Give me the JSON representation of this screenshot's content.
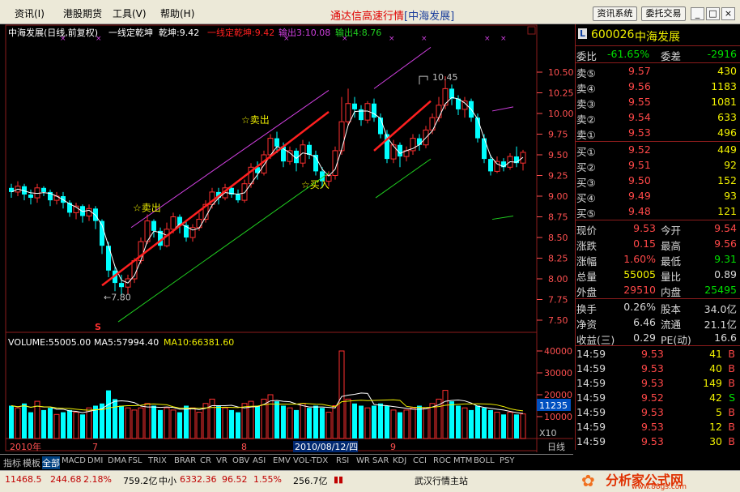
{
  "menu": {
    "items": [
      "资讯(I)",
      "港股期货",
      "工具(V)",
      "帮助(H)"
    ]
  },
  "app_title": {
    "prefix": "通达信高速行情",
    "stock": "[中海发展]"
  },
  "toolbar": {
    "info_system": "资讯系统",
    "order_trade": "委托交易",
    "min": "_",
    "max": "□",
    "close": "×"
  },
  "chart": {
    "header": {
      "name": "中海发展(日线,前复权)",
      "indicator": "一线定乾坤",
      "qk": "乾坤:9.42",
      "line_val": "一线定乾坤:9.42",
      "out": "输出3:10.08",
      "out4": "输出4:8.76"
    },
    "y_ticks": [
      "10.50",
      "10.25",
      "10.00",
      "9.75",
      "9.50",
      "9.25",
      "9.00",
      "8.75",
      "8.50",
      "8.25",
      "8.00",
      "7.75",
      "7.50"
    ],
    "annotations": {
      "sell1": "☆卖出",
      "sell2": "☆卖出",
      "buy": "☆买入",
      "low": "7.80",
      "high": "10.45",
      "s": "S"
    },
    "volume_header": {
      "vol": "VOLUME:55005.00",
      "ma5": "MA5:57994.40",
      "ma10": "MA10:66381.60"
    },
    "vol_ticks": [
      "40000",
      "30000",
      "20000",
      "10000"
    ],
    "vol_badge": "11235",
    "vol_unit": "X10",
    "dates": {
      "year": "2010年",
      "m7": "7",
      "m8": "8",
      "cursor": "2010/08/12/四",
      "m9": "9"
    },
    "period": "日线",
    "colors": {
      "up": "#ff3030",
      "down": "#00ffff",
      "trend": "#ff2020",
      "channel_top": "#d040e0",
      "channel_bottom": "#20d020"
    }
  },
  "tabs": [
    "指标",
    "模板",
    "全部",
    "MACD",
    "DMI",
    "DMA",
    "FSL",
    "TRIX",
    "BRAR",
    "CR",
    "VR",
    "OBV",
    "ASI",
    "EMV",
    "VOL-TDX",
    "RSI",
    "WR",
    "SAR",
    "KDJ",
    "CCI",
    "ROC",
    "MTM",
    "BOLL",
    "PSY"
  ],
  "quote": {
    "code": "600026",
    "name": "中海发展",
    "logo": "L",
    "weibi_label": "委比",
    "weibi": "-61.65%",
    "weicha_label": "委差",
    "weicha": "-2916",
    "asks": [
      {
        "label": "卖⑤",
        "price": "9.57",
        "vol": "430"
      },
      {
        "label": "卖④",
        "price": "9.56",
        "vol": "1183"
      },
      {
        "label": "卖③",
        "price": "9.55",
        "vol": "1081"
      },
      {
        "label": "卖②",
        "price": "9.54",
        "vol": "633"
      },
      {
        "label": "卖①",
        "price": "9.53",
        "vol": "496"
      }
    ],
    "bids": [
      {
        "label": "买①",
        "price": "9.52",
        "vol": "449"
      },
      {
        "label": "买②",
        "price": "9.51",
        "vol": "92"
      },
      {
        "label": "买③",
        "price": "9.50",
        "vol": "152"
      },
      {
        "label": "买④",
        "price": "9.49",
        "vol": "93"
      },
      {
        "label": "买⑤",
        "price": "9.48",
        "vol": "121"
      }
    ],
    "stats": [
      {
        "l1": "现价",
        "v1": "9.53",
        "l2": "今开",
        "v2": "9.54"
      },
      {
        "l1": "涨跌",
        "v1": "0.15",
        "l2": "最高",
        "v2": "9.56"
      },
      {
        "l1": "涨幅",
        "v1": "1.60%",
        "l2": "最低",
        "v2": "9.31"
      },
      {
        "l1": "总量",
        "v1": "55005",
        "l2": "量比",
        "v2": "0.89"
      },
      {
        "l1": "外盘",
        "v1": "29510",
        "l2": "内盘",
        "v2": "25495"
      }
    ],
    "fund": [
      {
        "l1": "换手",
        "v1": "0.26%",
        "l2": "股本",
        "v2": "34.0亿"
      },
      {
        "l1": "净资",
        "v1": "6.46",
        "l2": "流通",
        "v2": "21.1亿"
      },
      {
        "l1": "收益(三)",
        "v1": "0.29",
        "l2": "PE(动)",
        "v2": "16.6"
      }
    ],
    "ticks": [
      {
        "t": "14:59",
        "p": "9.53",
        "v": "41",
        "d": "B"
      },
      {
        "t": "14:59",
        "p": "9.53",
        "v": "40",
        "d": "B"
      },
      {
        "t": "14:59",
        "p": "9.53",
        "v": "149",
        "d": "B"
      },
      {
        "t": "14:59",
        "p": "9.52",
        "v": "42",
        "d": "S"
      },
      {
        "t": "14:59",
        "p": "9.53",
        "v": "5",
        "d": "B"
      },
      {
        "t": "14:59",
        "p": "9.53",
        "v": "12",
        "d": "B"
      },
      {
        "t": "14:59",
        "p": "9.53",
        "v": "30",
        "d": "B"
      }
    ]
  },
  "status": {
    "idx1": "11468.5",
    "ch1": "244.68",
    "pct1": "2.18%",
    "amt1": "759.2亿",
    "idx2_label": "中小",
    "idx2": "6332.36",
    "ch2": "96.52",
    "pct2": "1.55%",
    "amt2": "256.7亿",
    "server": "武汉行情主站",
    "watermark": "分析家公式网",
    "watermark_url": "www.88gs.com"
  }
}
